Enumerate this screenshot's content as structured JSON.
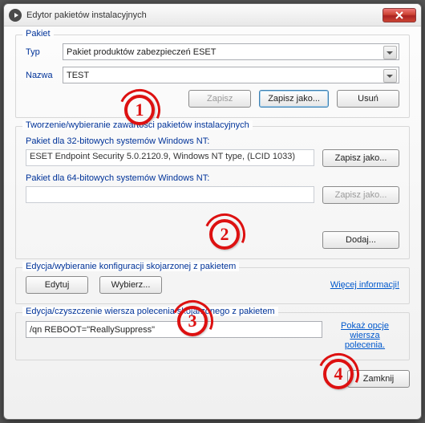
{
  "window": {
    "title": "Edytor pakietów instalacyjnych"
  },
  "pkg": {
    "group_title": "Pakiet",
    "type_label": "Typ",
    "type_value": "Pakiet produktów zabezpieczeń ESET",
    "name_label": "Nazwa",
    "name_value": "TEST",
    "save_label": "Zapisz",
    "saveas_label": "Zapisz jako...",
    "delete_label": "Usuń"
  },
  "content": {
    "group_title": "Tworzenie/wybieranie zawartości pakietów instalacyjnych",
    "pkg32_label": "Pakiet dla 32-bitowych systemów Windows NT:",
    "pkg32_value": "ESET Endpoint Security 5.0.2120.9, Windows NT type, (LCID 1033)",
    "pkg64_label": "Pakiet dla 64-bitowych systemów Windows NT:",
    "pkg64_value": "",
    "saveas32_label": "Zapisz jako...",
    "saveas64_label": "Zapisz jako...",
    "add_label": "Dodaj..."
  },
  "config": {
    "group_title": "Edycja/wybieranie konfiguracji skojarzonej z pakietem",
    "edit_label": "Edytuj",
    "choose_label": "Wybierz...",
    "more_info_label": "Więcej informacji!"
  },
  "cmdline": {
    "group_title": "Edycja/czyszczenie wiersza polecenia skojarzonego z pakietem",
    "value": "/qn REBOOT=\"ReallySuppress\"",
    "show_opts_label": "Pokaż opcje wiersza polecenia."
  },
  "footer": {
    "close_label": "Zamknij"
  },
  "annotations": [
    "1",
    "2",
    "3",
    "4"
  ]
}
